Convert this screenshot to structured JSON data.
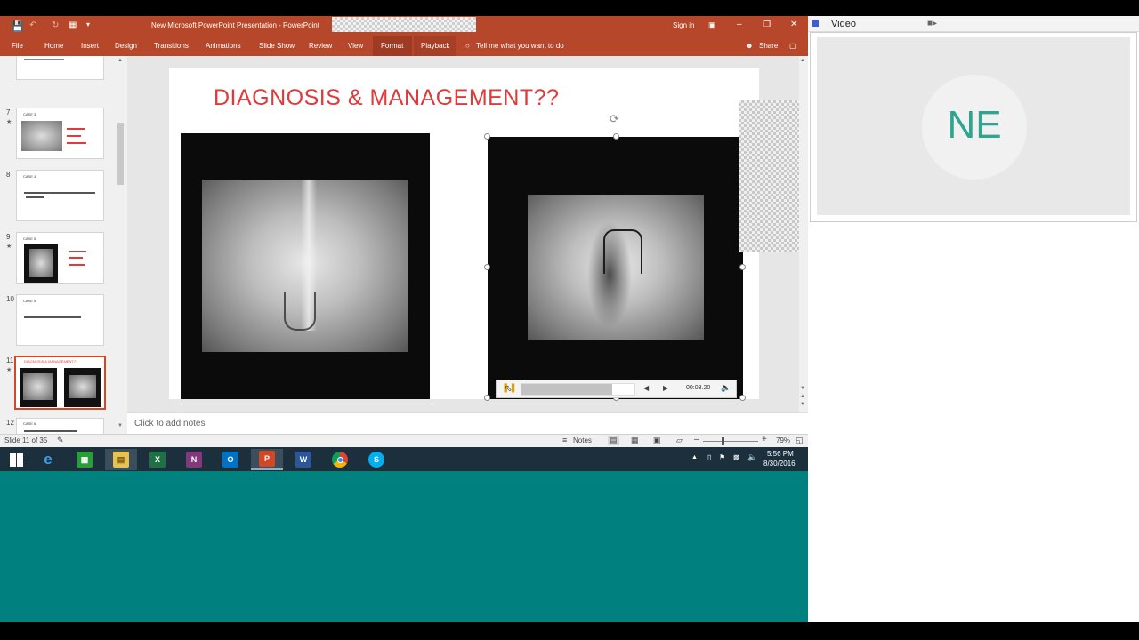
{
  "window": {
    "title": "New Microsoft PowerPoint Presentation - PowerPoint",
    "sign_in": "Sign in"
  },
  "ribbon": {
    "tabs": [
      "File",
      "Home",
      "Insert",
      "Design",
      "Transitions",
      "Animations",
      "Slide Show",
      "Review",
      "View",
      "Format",
      "Playback"
    ],
    "tell_me": "Tell me what you want to do",
    "share": "Share"
  },
  "thumbnails": [
    {
      "number": "7",
      "star": "★",
      "heading": "CASE 3"
    },
    {
      "number": "8",
      "star": "",
      "heading": "CASE 4"
    },
    {
      "number": "9",
      "star": "★",
      "heading": "CASE 5"
    },
    {
      "number": "10",
      "star": "",
      "heading": "CASE 5"
    },
    {
      "number": "11",
      "star": "★",
      "heading": "DIAGNOSIS & MANAGEMENT??"
    },
    {
      "number": "12",
      "star": "",
      "heading": "CASE 6"
    }
  ],
  "slide": {
    "title": "DIAGNOSIS & MANAGEMENT??"
  },
  "media": {
    "time": "00:03.20",
    "progress": 0.8
  },
  "notes_placeholder": "Click to add notes",
  "status": {
    "slide_info": "Slide 11 of 35",
    "notes": "Notes",
    "zoom": "79%"
  },
  "taskbar": {
    "apps": [
      "ie-icon",
      "store-icon",
      "explorer-icon",
      "excel-icon",
      "onenote-icon",
      "outlook-icon",
      "powerpoint-icon",
      "word-icon",
      "chrome-icon",
      "skype-icon"
    ],
    "time": "5:56 PM",
    "date": "8/30/2016"
  },
  "video_panel": {
    "title": "Video",
    "initials": "NE"
  },
  "colors": {
    "accent": "#b7472a",
    "slide_title": "#e03a3a",
    "desktop": "#00807f",
    "avatar_text": "#2ea58f"
  }
}
